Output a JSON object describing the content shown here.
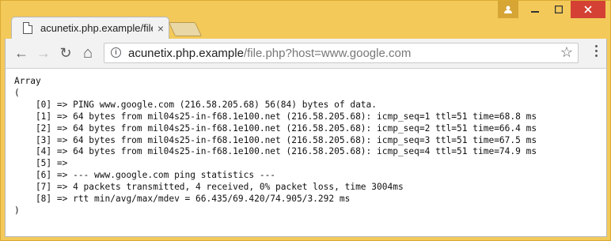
{
  "window": {
    "user_icon": "user-icon",
    "minimize_icon": "minimize-icon",
    "maximize_icon": "maximize-icon",
    "close_icon": "close-icon"
  },
  "tab": {
    "title": "acunetix.php.example/file",
    "close_glyph": "×"
  },
  "toolbar": {
    "back_glyph": "←",
    "forward_glyph": "→",
    "reload_glyph": "↻",
    "home_glyph": "⌂",
    "info_glyph": "i",
    "star_glyph": "☆"
  },
  "address": {
    "host": "acunetix.php.example",
    "path": "/file.php?host=www.google.com"
  },
  "content": {
    "lines": [
      "Array",
      "(",
      "    [0] => PING www.google.com (216.58.205.68) 56(84) bytes of data.",
      "    [1] => 64 bytes from mil04s25-in-f68.1e100.net (216.58.205.68): icmp_seq=1 ttl=51 time=68.8 ms",
      "    [2] => 64 bytes from mil04s25-in-f68.1e100.net (216.58.205.68): icmp_seq=2 ttl=51 time=66.4 ms",
      "    [3] => 64 bytes from mil04s25-in-f68.1e100.net (216.58.205.68): icmp_seq=3 ttl=51 time=67.5 ms",
      "    [4] => 64 bytes from mil04s25-in-f68.1e100.net (216.58.205.68): icmp_seq=4 ttl=51 time=74.9 ms",
      "    [5] =>",
      "    [6] => --- www.google.com ping statistics ---",
      "    [7] => 4 packets transmitted, 4 received, 0% packet loss, time 3004ms",
      "    [8] => rtt min/avg/max/mdev = 66.435/69.420/74.905/3.292 ms",
      ")"
    ]
  }
}
